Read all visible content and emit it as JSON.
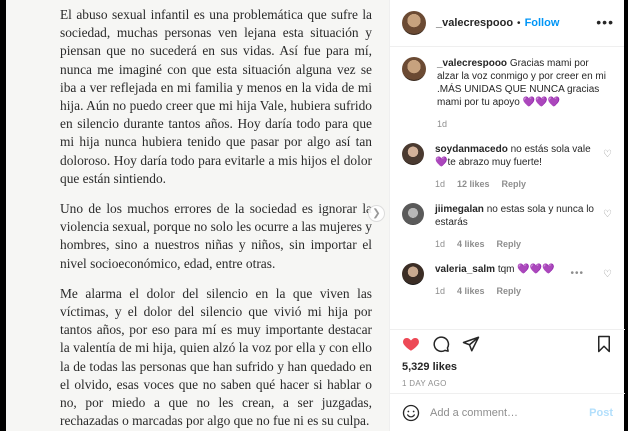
{
  "letter": {
    "p1": "El abuso sexual infantil es una problemática que sufre la sociedad, muchas personas ven lejana esta situación y piensan que no sucederá en sus vidas. Así fue para mí, nunca me imaginé con que esta situación alguna vez se iba a ver reflejada en mi familia y menos en la vida de mi hija. Aún no puedo creer que mi hija Vale, hubiera sufrido en silencio durante tantos años. Hoy daría todo para que mi hija nunca hubiera tenido que pasar por algo así tan doloroso. Hoy daría todo para evitarle a mis hijos el dolor que están sintiendo.",
    "p2": "Uno de los muchos errores de la sociedad es ignorar la violencia sexual, porque no solo les ocurre a las mujeres y hombres, sino a nuestros niñas y niños, sin importar el nivel socioeconómico, edad, entre otras.",
    "p3": "Me alarma el dolor del silencio en la que viven las víctimas, y el dolor del silencio que vivió mi hija por tantos años, por eso para mí es muy importante destacar la valentía de mi hija, quien alzó la voz por ella y con ello la de todas las personas que han sufrido y han quedado en el olvido, esas voces que no saben qué hacer si hablar o no, por miedo a que no les crean, a ser juzgadas, rechazadas o marcadas por algo que no fue ni es su culpa."
  },
  "header": {
    "username": "_valecrespooo",
    "separator": "•",
    "follow": "Follow",
    "more": "•••"
  },
  "comments": [
    {
      "user": "_valecrespooo",
      "text": "Gracias mami por alzar la voz conmigo y por creer en mi .MÁS UNIDAS QUE NUNCA gracias mami por tu apoyo",
      "emoji": "💜💜💜",
      "time": "1d"
    },
    {
      "user": "soydanmacedo",
      "text_a": "no estás sola vale",
      "emoji": "💜",
      "text_b": "te abrazo muy fuerte!",
      "time": "1d",
      "likes": "12 likes",
      "reply": "Reply"
    },
    {
      "user": "jiimegalan",
      "text": "no estas sola y nunca lo estarás",
      "time": "1d",
      "likes": "4 likes",
      "reply": "Reply"
    },
    {
      "user": "valeria_salm",
      "text": "tqm",
      "emoji": "💜💜💜",
      "time": "1d",
      "likes": "4 likes",
      "reply": "Reply",
      "more": "•••"
    }
  ],
  "actions": {
    "likes": "5,329 likes",
    "date": "1 DAY AGO"
  },
  "add_comment": {
    "placeholder": "Add a comment…",
    "post": "Post"
  },
  "colors": {
    "accent": "#0095f6",
    "like_red": "#ed4956",
    "purple_heart": "#9c3cf0"
  }
}
